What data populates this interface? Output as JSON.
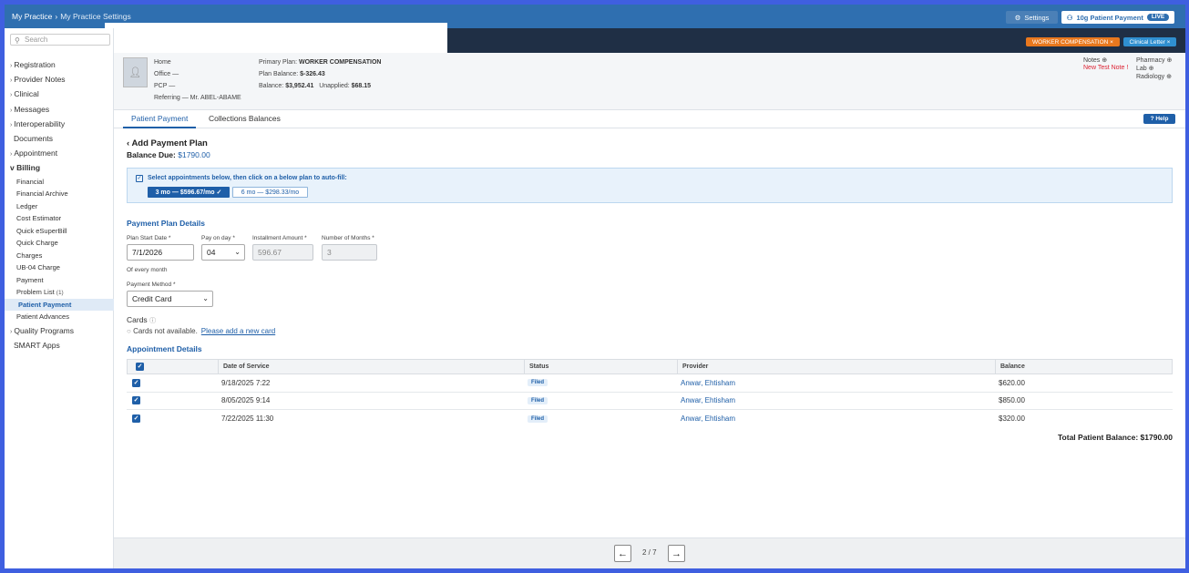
{
  "breadcrumb": [
    "My Practice",
    "My Practice Settings"
  ],
  "header": {
    "settings_label": "Settings",
    "payment_label": "10g Patient Payment",
    "live_badge": "LIVE"
  },
  "tags": {
    "worker_comp": "WORKER COMPENSATION ×",
    "clinical_letter": "Clinical Letter ×"
  },
  "sidebar": {
    "search_placeholder": "Search",
    "items": [
      {
        "label": "Registration",
        "chev": "›"
      },
      {
        "label": "Provider Notes",
        "chev": "›"
      },
      {
        "label": "Clinical",
        "chev": "›"
      },
      {
        "label": "Messages",
        "chev": "›"
      },
      {
        "label": "Interoperability",
        "chev": "›"
      },
      {
        "label": "Documents",
        "chev": ""
      },
      {
        "label": "Appointment",
        "chev": "›"
      }
    ],
    "billing_label": "v Billing",
    "billing_items": [
      "Financial",
      "Financial Archive",
      "Ledger",
      "Cost Estimator",
      "Quick eSuperBill",
      "Quick Charge",
      "Charges",
      "UB-04 Charge",
      "Payment"
    ],
    "problem_list": "Problem List",
    "problem_count": "(1)",
    "patient_payment": "Patient Payment",
    "patient_advances": "Patient Advances",
    "quality_programs": "Quality Programs",
    "smart_apps": "SMART Apps"
  },
  "patient": {
    "home": "Home",
    "office": "Office —",
    "pcp": "PCP —",
    "referring": "Referring — Mr. ABEL-ABAME",
    "primary_plan_label": "Primary Plan:",
    "primary_plan": "WORKER COMPENSATION",
    "plan_balance_label": "Plan Balance:",
    "plan_balance": "$-326.43",
    "balance_label": "Balance:",
    "balance": "$3,952.41",
    "unapplied_label": "Unapplied:",
    "unapplied": "$68.15",
    "notes": "Notes ⊕",
    "new_test_note": "New Test Note !",
    "pharmacy": "Pharmacy ⊕",
    "lab": "Lab ⊕",
    "radiology": "Radiology ⊕"
  },
  "tabs": {
    "patient_payment": "Patient Payment",
    "collections": "Collections Balances",
    "help": "? Help"
  },
  "form": {
    "title": "‹ Add Payment Plan",
    "balance_due_label": "Balance Due:",
    "balance_due": "$1790.00",
    "autofill_text": "Select appointments below, then click on a below plan to auto-fill:",
    "plan_3": "3 mo — $596.67/mo ✓",
    "plan_6": "6 mo — $298.33/mo",
    "details_heading": "Payment Plan Details",
    "start_label": "Plan Start Date *",
    "start_value": "7/1/2026",
    "day_label": "Pay on day *",
    "day_value": "04",
    "installment_label": "Installment Amount *",
    "installment_value": "596.67",
    "months_label": "Number of Months *",
    "months_value": "3",
    "every_month": "Of every month",
    "method_label": "Payment Method *",
    "method_value": "Credit Card",
    "cards_label": "Cards",
    "cards_none": "Cards not available.",
    "add_card": "Please add a new card",
    "appt_heading": "Appointment Details"
  },
  "table": {
    "headers": [
      "Date of Service",
      "Status",
      "Provider",
      "Balance"
    ],
    "rows": [
      {
        "date": "9/18/2025 7:22",
        "status": "Filed",
        "provider": "Anwar, Ehtisham",
        "balance": "$620.00"
      },
      {
        "date": "8/05/2025 9:14",
        "status": "Filed",
        "provider": "Anwar, Ehtisham",
        "balance": "$850.00"
      },
      {
        "date": "7/22/2025 11:30",
        "status": "Filed",
        "provider": "Anwar, Ehtisham",
        "balance": "$320.00"
      }
    ],
    "total_label": "Total Patient Balance:",
    "total_value": "$1790.00"
  },
  "pager": {
    "prev": "←",
    "next": "→",
    "page": "2 / 7"
  }
}
